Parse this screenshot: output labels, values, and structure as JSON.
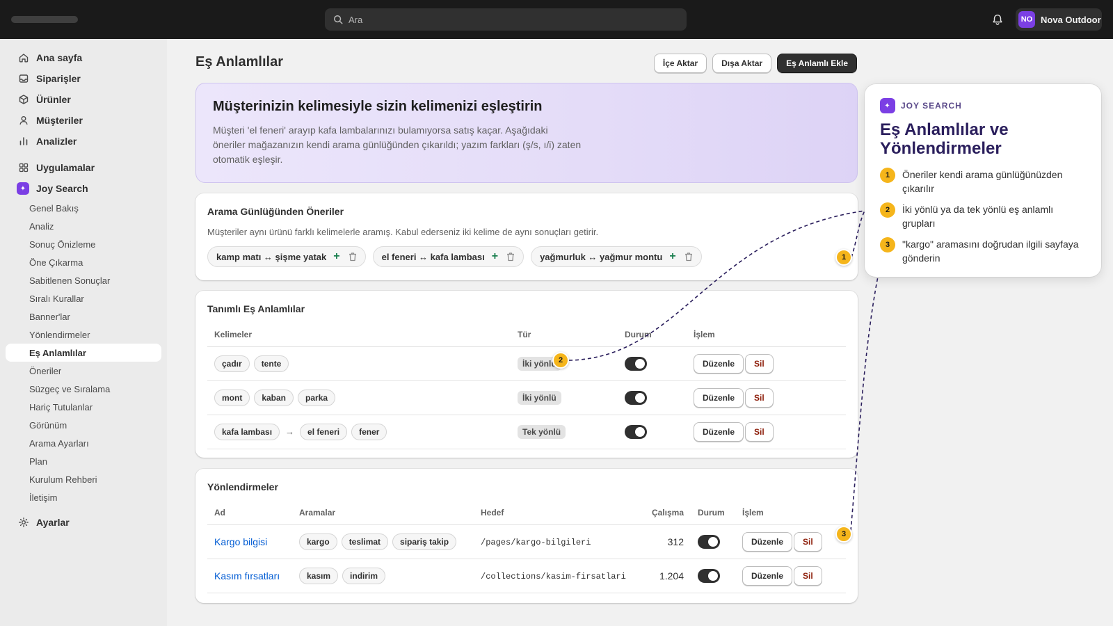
{
  "topbar": {
    "search_placeholder": "Ara",
    "store_initials": "NO",
    "store_name": "Nova Outdoor"
  },
  "sidebar": {
    "main_items": [
      {
        "label": "Ana sayfa",
        "icon": "home-icon"
      },
      {
        "label": "Siparişler",
        "icon": "inbox-icon"
      },
      {
        "label": "Ürünler",
        "icon": "tag-icon"
      },
      {
        "label": "Müşteriler",
        "icon": "person-icon"
      },
      {
        "label": "Analizler",
        "icon": "bar-chart-icon"
      }
    ],
    "apps_label": "Uygulamalar",
    "app_name": "Joy Search",
    "app_items": [
      "Genel Bakış",
      "Analiz",
      "Sonuç Önizleme",
      "Öne Çıkarma",
      "Sabitlenen Sonuçlar",
      "Sıralı Kurallar",
      "Banner'lar",
      "Yönlendirmeler",
      "Eş Anlamlılar",
      "Öneriler",
      "Süzgeç ve Sıralama",
      "Hariç Tutulanlar",
      "Görünüm",
      "Arama Ayarları",
      "Plan",
      "Kurulum Rehberi",
      "İletişim"
    ],
    "active_item": "Eş Anlamlılar",
    "settings_label": "Ayarlar"
  },
  "page": {
    "title": "Eş Anlamlılar",
    "import_label": "İçe Aktar",
    "export_label": "Dışa Aktar",
    "add_label": "Eş Anlamlı Ekle"
  },
  "hero": {
    "title": "Müşterinizin kelimesiyle sizin kelimenizi eşleştirin",
    "text": "Müşteri 'el feneri' arayıp kafa lambalarınızı bulamıyorsa satış kaçar. Aşağıdaki öneriler mağazanızın kendi arama günlüğünden çıkarıldı; yazım farkları (ş/s, ı/i) zaten otomatik eşleşir."
  },
  "suggestions": {
    "title": "Arama Günlüğünden Öneriler",
    "subtitle": "Müşteriler aynı ürünü farklı kelimelerle aramış. Kabul ederseniz iki kelime de aynı sonuçları getirir.",
    "items": [
      "kamp matı ↔ şişme yatak",
      "el feneri ↔ kafa lambası",
      "yağmurluk ↔ yağmur montu"
    ]
  },
  "synonyms": {
    "title": "Tanımlı Eş Anlamlılar",
    "columns": [
      "Kelimeler",
      "Tür",
      "Durum",
      "İşlem"
    ],
    "rows": [
      {
        "words": [
          "çadır",
          "tente"
        ],
        "type": "İki yönlü",
        "enabled": true
      },
      {
        "words": [
          "mont",
          "kaban",
          "parka"
        ],
        "type": "İki yönlü",
        "enabled": true
      },
      {
        "source": "kafa lambası",
        "words": [
          "el feneri",
          "fener"
        ],
        "type": "Tek yönlü",
        "enabled": true
      }
    ],
    "edit_label": "Düzenle",
    "delete_label": "Sil"
  },
  "redirects": {
    "title": "Yönlendirmeler",
    "columns": [
      "Ad",
      "Aramalar",
      "Hedef",
      "Çalışma",
      "Durum",
      "İşlem"
    ],
    "rows": [
      {
        "name": "Kargo bilgisi",
        "terms": [
          "kargo",
          "teslimat",
          "sipariş takip"
        ],
        "target": "/pages/kargo-bilgileri",
        "runs": "312",
        "enabled": true
      },
      {
        "name": "Kasım fırsatları",
        "terms": [
          "kasım",
          "indirim"
        ],
        "target": "/collections/kasim-firsatlari",
        "runs": "1.204",
        "enabled": true
      }
    ],
    "edit_label": "Düzenle",
    "delete_label": "Sil"
  },
  "panel": {
    "brand": "JOY SEARCH",
    "title": "Eş Anlamlılar ve Yönlendirmeler",
    "steps": [
      {
        "num": "1",
        "text": "Öneriler kendi arama günlüğünüzden çıkarılır"
      },
      {
        "num": "2",
        "text": "İki yönlü ya da tek yönlü eş anlamlı grupları"
      },
      {
        "num": "3",
        "text": "\"kargo\" aramasını doğrudan ilgili sayfaya gönderin"
      }
    ]
  },
  "markers": [
    "1",
    "2",
    "3"
  ],
  "colors": {
    "accent_purple": "#7b3fe4",
    "marker_yellow": "#f5b51b",
    "link_blue": "#005bd3",
    "danger_red": "#8e1f0b",
    "connector_navy": "#2a1e5c"
  }
}
